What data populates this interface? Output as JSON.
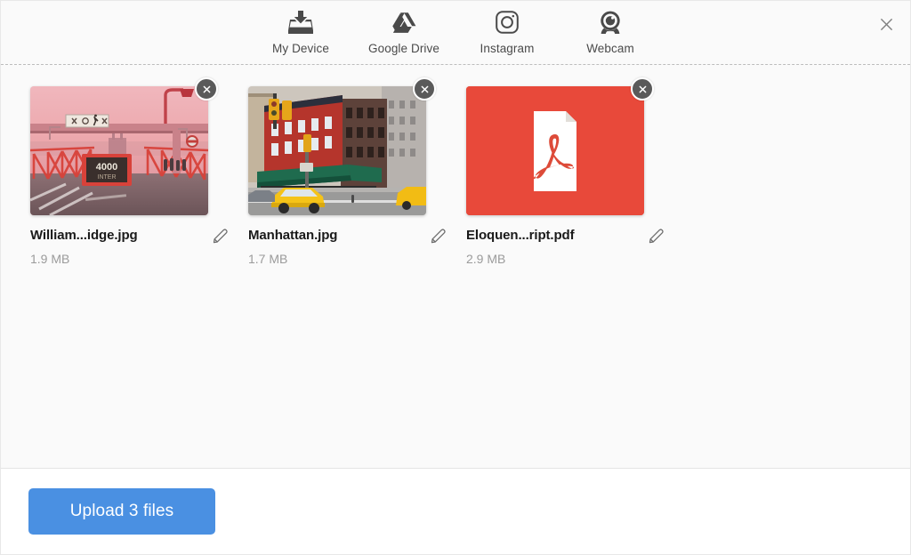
{
  "dialog": {
    "close_icon": "close-icon",
    "background": "#fafafa"
  },
  "sources": {
    "tabs": [
      {
        "label": "My Device",
        "icon": "device-upload-tray-icon",
        "active": true
      },
      {
        "label": "Google Drive",
        "icon": "google-drive-icon",
        "active": false
      },
      {
        "label": "Instagram",
        "icon": "instagram-icon",
        "active": false
      },
      {
        "label": "Webcam",
        "icon": "webcam-icon",
        "active": false
      }
    ]
  },
  "files": [
    {
      "name": "William...idge.jpg",
      "size": "1.9 MB",
      "type": "image",
      "thumb": "williamsburg-bridge-photo",
      "remove_icon": "close-icon",
      "edit_icon": "pencil-icon"
    },
    {
      "name": "Manhattan.jpg",
      "size": "1.7 MB",
      "type": "image",
      "thumb": "manhattan-street-photo",
      "remove_icon": "close-icon",
      "edit_icon": "pencil-icon"
    },
    {
      "name": "Eloquen...ript.pdf",
      "size": "2.9 MB",
      "type": "pdf",
      "thumb": "pdf-document-icon",
      "remove_icon": "close-icon",
      "edit_icon": "pencil-icon",
      "accent_color": "#e8493a"
    }
  ],
  "footer": {
    "upload_label": "Upload 3 files",
    "upload_color": "#4a90e2"
  }
}
